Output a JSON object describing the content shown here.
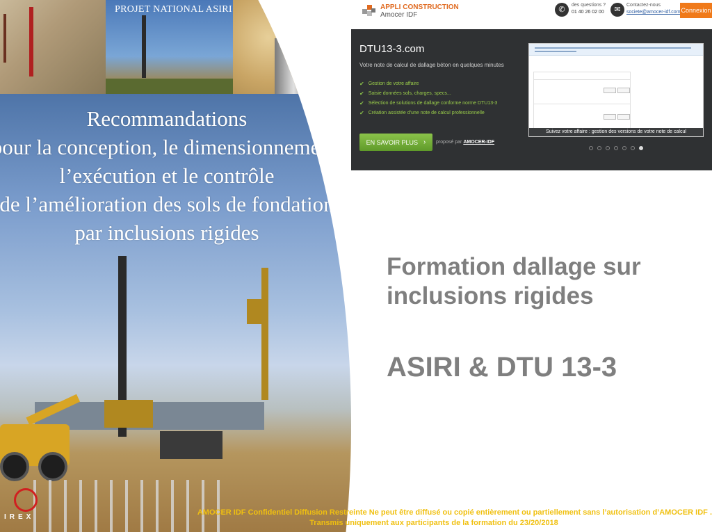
{
  "cover": {
    "caption": "PROJET NATIONAL ASIRI",
    "title": "Recommandations\npour la conception, le dimensionnement,\nl’exécution et le contrôle\nde l’amélioration des sols de fondation\npar inclusions rigides",
    "logo_text": "IREX"
  },
  "app_header": {
    "brand_line_1": "APPLI CONSTRUCTION",
    "brand_line_2": "Amocer IDF",
    "phone_label": "des questions ?",
    "phone_number": "01 40 26 02 00",
    "contact_label": "Contactez-nous",
    "contact_email": "societe@amocer-idf.com",
    "login_label": "Connexion",
    "icons": {
      "logo": "amocer-logo-icon",
      "phone": "phone-icon",
      "mail": "mail-icon"
    }
  },
  "app_banner": {
    "title": "DTU13-3.com",
    "subtitle": "Votre note de calcul de dallage béton en quelques minutes",
    "features": [
      "Gestion de votre affaire",
      "Saisie données sols, charges, specs...",
      "Sélection de solutions de dallage conforme norme DTU13-3",
      "Création assistée d'une note de calcul professionnelle"
    ],
    "cta_label": "EN SAVOIR PLUS",
    "proposed_by_prefix": "proposé par",
    "proposed_by_brand": "AMOCER-IDF",
    "thumb_caption": "Suivez votre affaire : gestion des versions de votre note de calcul",
    "carousel_total": 7,
    "carousel_active": 7,
    "colors": {
      "accent": "#8bc34a",
      "dark": "#2f3133",
      "orange": "#f07a1a"
    }
  },
  "headline": "Formation dallage sur\ninclusions rigides",
  "subheadline": "ASIRI & DTU 13-3",
  "footer": {
    "line_1": "AMOCER IDF Confidentiel    Diffusion Restreinte  Ne peut être diffusé ou copié entièrement ou partiellement sans l’autorisation d’AMOCER IDF .",
    "line_2": "Transmis uniquement aux participants de la formation du 23/20/2018",
    "color": "#f0c010"
  }
}
